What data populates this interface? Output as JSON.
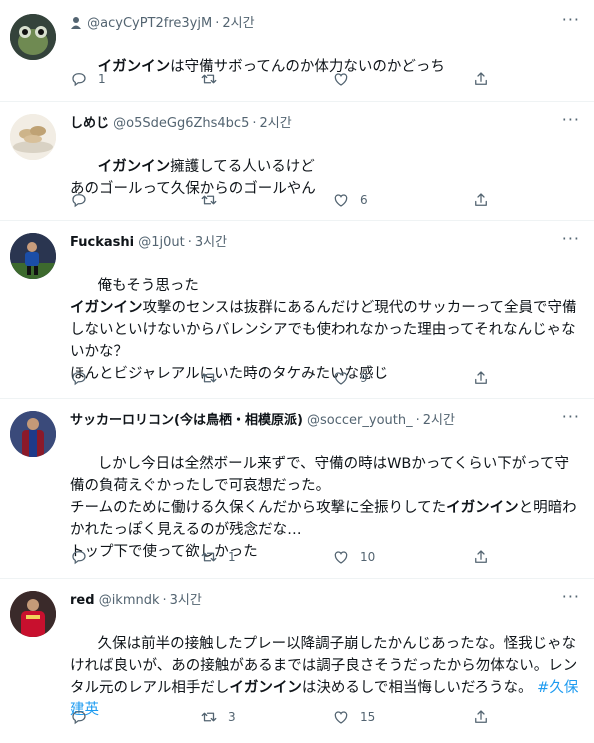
{
  "tweets": [
    {
      "display_name": "",
      "handle": "@acyCyPT2fre3yjM",
      "time": "2시간",
      "segments": [
        {
          "t": "イガンイン",
          "b": true
        },
        {
          "t": "は守備サボってんのか体力ないのかどっち",
          "b": false
        }
      ],
      "counts": {
        "reply": "1",
        "retweet": "",
        "like": ""
      }
    },
    {
      "display_name": "しめじ",
      "handle": "@o5SdeGg6Zhs4bc5",
      "time": "2시간",
      "segments": [
        {
          "t": "イガンイン",
          "b": true
        },
        {
          "t": "擁護してる人いるけど\nあのゴールって久保からのゴールやん",
          "b": false
        }
      ],
      "counts": {
        "reply": "",
        "retweet": "",
        "like": "6"
      }
    },
    {
      "display_name": "Fuckashi",
      "handle": "@1j0ut",
      "time": "3시간",
      "segments": [
        {
          "t": "俺もそう思った\n",
          "b": false
        },
        {
          "t": "イガンイン",
          "b": true
        },
        {
          "t": "攻撃のセンスは抜群にあるんだけど現代のサッカーって全員で守備しないといけないからバレンシアでも使われなかった理由ってそれなんじゃないかな？\nほんとビジャレアルにいた時のタケみたいな感じ",
          "b": false
        }
      ],
      "counts": {
        "reply": "",
        "retweet": "",
        "like": "9"
      }
    },
    {
      "display_name": "サッカーロリコン(今は鳥栖・相模原派)",
      "handle": "@soccer_youth_",
      "time": "2시간",
      "segments": [
        {
          "t": "しかし今日は全然ボール来ずで、守備の時はWBかってくらい下がって守備の負荷えぐかったしで可哀想だった。\nチームのために働ける久保くんだから攻撃に全振りしてた",
          "b": false
        },
        {
          "t": "イガンイン",
          "b": true
        },
        {
          "t": "と明暗わかれたっぽく見えるのが残念だな…\nトップ下で使って欲しかった",
          "b": false
        }
      ],
      "counts": {
        "reply": "",
        "retweet": "1",
        "like": "10"
      }
    },
    {
      "display_name": "red",
      "handle": "@ikmndk",
      "time": "3시간",
      "segments": [
        {
          "t": "久保は前半の接触したプレー以降調子崩したかんじあったな。怪我じゃなければ良いが、あの接触があるまでは調子良さそうだったから勿体ない。レンタル元のレアル相手だし",
          "b": false
        },
        {
          "t": "イガンイン",
          "b": true
        },
        {
          "t": "は決めるしで相当悔しいだろうな。 ",
          "b": false
        },
        {
          "t": "#久保建英",
          "b": false,
          "hashtag": true
        }
      ],
      "counts": {
        "reply": "",
        "retweet": "3",
        "like": "15"
      }
    }
  ],
  "colors": {
    "text": "#0f1419",
    "muted": "#536471",
    "link": "#1d9bf0",
    "divider": "#eff3f4"
  }
}
